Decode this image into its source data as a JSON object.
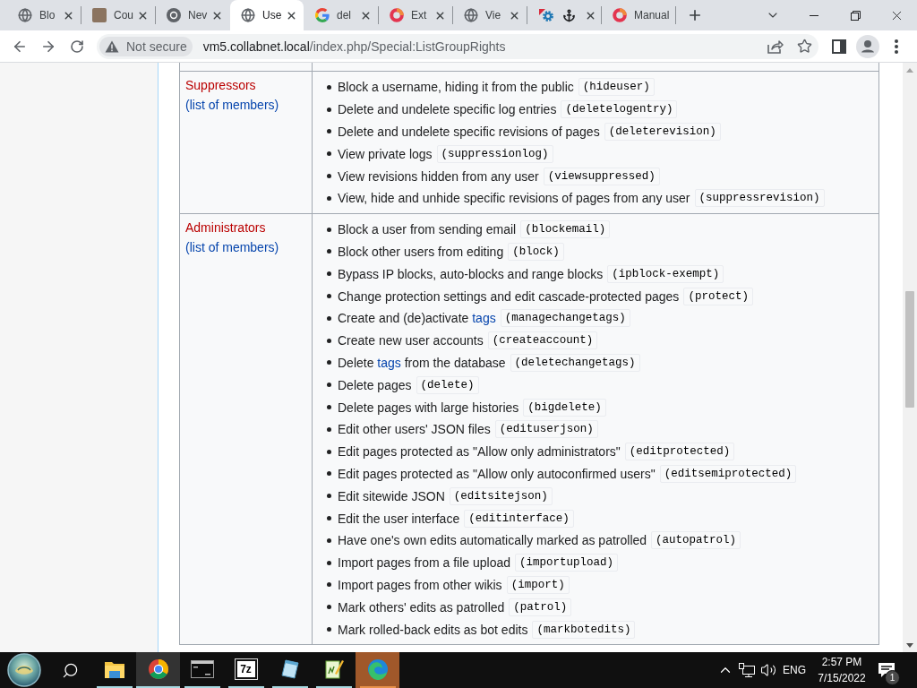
{
  "browser_tabs": [
    {
      "title": "Blo",
      "icons": [
        {
          "kind": "globe"
        }
      ],
      "selected": false,
      "closable": true
    },
    {
      "title": "Cou",
      "icons": [
        {
          "kind": "photo"
        }
      ],
      "selected": false,
      "closable": true
    },
    {
      "title": "Nev",
      "icons": [
        {
          "kind": "chromium"
        }
      ],
      "selected": false,
      "closable": true
    },
    {
      "title": "Use",
      "icons": [
        {
          "kind": "globe"
        }
      ],
      "selected": true,
      "closable": true
    },
    {
      "title": "del",
      "icons": [
        {
          "kind": "google"
        }
      ],
      "selected": false,
      "closable": true
    },
    {
      "title": "Ext",
      "icons": [
        {
          "kind": "ring"
        }
      ],
      "selected": false,
      "closable": true
    },
    {
      "title": "Vie",
      "icons": [
        {
          "kind": "globe"
        }
      ],
      "selected": false,
      "closable": true
    },
    {
      "icons": [
        {
          "kind": "gear"
        },
        {
          "kind": "anchor"
        }
      ],
      "selected": false,
      "closable": true
    },
    {
      "title": "Manual",
      "icons": [
        {
          "kind": "ring"
        }
      ],
      "selected": false,
      "closable": false
    }
  ],
  "address_bar": {
    "security_label": "Not secure",
    "host": "vm5.collabnet.local",
    "path": "/index.php/Special:ListGroupRights"
  },
  "rights_table": {
    "rows": [
      {
        "group": "Suppressors",
        "members_link": "(list of members)",
        "rights": [
          {
            "text": "Block a username, hiding it from the public",
            "code": "(hideuser)"
          },
          {
            "text": "Delete and undelete specific log entries",
            "code": "(deletelogentry)"
          },
          {
            "text": "Delete and undelete specific revisions of pages",
            "code": "(deleterevision)"
          },
          {
            "text": "View private logs",
            "code": "(suppressionlog)"
          },
          {
            "text": "View revisions hidden from any user",
            "code": "(viewsuppressed)"
          },
          {
            "text": "View, hide and unhide specific revisions of pages from any user",
            "code": "(suppressrevision)"
          }
        ]
      },
      {
        "group": "Administrators",
        "members_link": "(list of members)",
        "rights": [
          {
            "text": "Block a user from sending email",
            "code": "(blockemail)"
          },
          {
            "text": "Block other users from editing",
            "code": "(block)"
          },
          {
            "text": "Bypass IP blocks, auto-blocks and range blocks",
            "code": "(ipblock-exempt)"
          },
          {
            "text": "Change protection settings and edit cascade-protected pages",
            "code": "(protect)"
          },
          {
            "text": "Create and (de)activate ",
            "link": "tags",
            "code": "(managechangetags)"
          },
          {
            "text": "Create new user accounts",
            "code": "(createaccount)"
          },
          {
            "text": "Delete ",
            "link": "tags",
            "text_after": " from the database",
            "code": "(deletechangetags)"
          },
          {
            "text": "Delete pages",
            "code": "(delete)"
          },
          {
            "text": "Delete pages with large histories",
            "code": "(bigdelete)"
          },
          {
            "text": "Edit other users' JSON files",
            "code": "(edituserjson)"
          },
          {
            "text": "Edit pages protected as \"Allow only administrators\"",
            "code": "(editprotected)"
          },
          {
            "text": "Edit pages protected as \"Allow only autoconfirmed users\"",
            "code": "(editsemiprotected)"
          },
          {
            "text": "Edit sitewide JSON",
            "code": "(editsitejson)"
          },
          {
            "text": "Edit the user interface",
            "code": "(editinterface)"
          },
          {
            "text": "Have one's own edits automatically marked as patrolled",
            "code": "(autopatrol)"
          },
          {
            "text": "Import pages from a file upload",
            "code": "(importupload)"
          },
          {
            "text": "Import pages from other wikis",
            "code": "(import)"
          },
          {
            "text": "Mark others' edits as patrolled",
            "code": "(patrol)"
          },
          {
            "text": "Mark rolled-back edits as bot edits",
            "code": "(markbotedits)"
          }
        ]
      }
    ]
  },
  "taskbar": {
    "apps": [
      {
        "kind": "explorer",
        "running": true,
        "selected": false,
        "flashing": false
      },
      {
        "kind": "browser",
        "running": true,
        "selected": true,
        "flashing": false
      },
      {
        "kind": "terminal",
        "running": true,
        "selected": false,
        "flashing": false
      },
      {
        "kind": "archiver",
        "logo_text": "7z",
        "running": true,
        "selected": false,
        "flashing": false
      },
      {
        "kind": "notepad",
        "running": true,
        "selected": false,
        "flashing": false
      },
      {
        "kind": "editor",
        "running": true,
        "selected": false,
        "flashing": false
      },
      {
        "kind": "edge",
        "running": true,
        "selected": false,
        "flashing": true
      }
    ],
    "language": "ENG",
    "time": "2:57 PM",
    "date": "7/15/2022",
    "notification_count": "1"
  }
}
